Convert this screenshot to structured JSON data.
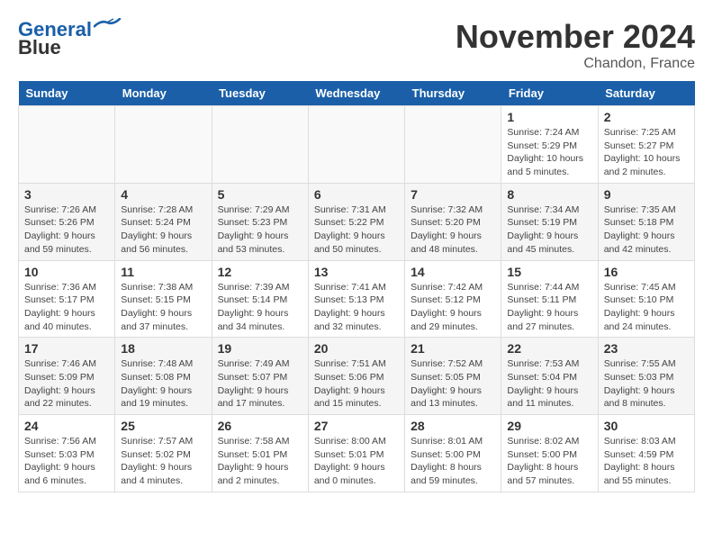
{
  "header": {
    "logo_line1": "General",
    "logo_line2": "Blue",
    "month_title": "November 2024",
    "location": "Chandon, France"
  },
  "weekdays": [
    "Sunday",
    "Monday",
    "Tuesday",
    "Wednesday",
    "Thursday",
    "Friday",
    "Saturday"
  ],
  "weeks": [
    [
      {
        "day": "",
        "info": ""
      },
      {
        "day": "",
        "info": ""
      },
      {
        "day": "",
        "info": ""
      },
      {
        "day": "",
        "info": ""
      },
      {
        "day": "",
        "info": ""
      },
      {
        "day": "1",
        "info": "Sunrise: 7:24 AM\nSunset: 5:29 PM\nDaylight: 10 hours\nand 5 minutes."
      },
      {
        "day": "2",
        "info": "Sunrise: 7:25 AM\nSunset: 5:27 PM\nDaylight: 10 hours\nand 2 minutes."
      }
    ],
    [
      {
        "day": "3",
        "info": "Sunrise: 7:26 AM\nSunset: 5:26 PM\nDaylight: 9 hours\nand 59 minutes."
      },
      {
        "day": "4",
        "info": "Sunrise: 7:28 AM\nSunset: 5:24 PM\nDaylight: 9 hours\nand 56 minutes."
      },
      {
        "day": "5",
        "info": "Sunrise: 7:29 AM\nSunset: 5:23 PM\nDaylight: 9 hours\nand 53 minutes."
      },
      {
        "day": "6",
        "info": "Sunrise: 7:31 AM\nSunset: 5:22 PM\nDaylight: 9 hours\nand 50 minutes."
      },
      {
        "day": "7",
        "info": "Sunrise: 7:32 AM\nSunset: 5:20 PM\nDaylight: 9 hours\nand 48 minutes."
      },
      {
        "day": "8",
        "info": "Sunrise: 7:34 AM\nSunset: 5:19 PM\nDaylight: 9 hours\nand 45 minutes."
      },
      {
        "day": "9",
        "info": "Sunrise: 7:35 AM\nSunset: 5:18 PM\nDaylight: 9 hours\nand 42 minutes."
      }
    ],
    [
      {
        "day": "10",
        "info": "Sunrise: 7:36 AM\nSunset: 5:17 PM\nDaylight: 9 hours\nand 40 minutes."
      },
      {
        "day": "11",
        "info": "Sunrise: 7:38 AM\nSunset: 5:15 PM\nDaylight: 9 hours\nand 37 minutes."
      },
      {
        "day": "12",
        "info": "Sunrise: 7:39 AM\nSunset: 5:14 PM\nDaylight: 9 hours\nand 34 minutes."
      },
      {
        "day": "13",
        "info": "Sunrise: 7:41 AM\nSunset: 5:13 PM\nDaylight: 9 hours\nand 32 minutes."
      },
      {
        "day": "14",
        "info": "Sunrise: 7:42 AM\nSunset: 5:12 PM\nDaylight: 9 hours\nand 29 minutes."
      },
      {
        "day": "15",
        "info": "Sunrise: 7:44 AM\nSunset: 5:11 PM\nDaylight: 9 hours\nand 27 minutes."
      },
      {
        "day": "16",
        "info": "Sunrise: 7:45 AM\nSunset: 5:10 PM\nDaylight: 9 hours\nand 24 minutes."
      }
    ],
    [
      {
        "day": "17",
        "info": "Sunrise: 7:46 AM\nSunset: 5:09 PM\nDaylight: 9 hours\nand 22 minutes."
      },
      {
        "day": "18",
        "info": "Sunrise: 7:48 AM\nSunset: 5:08 PM\nDaylight: 9 hours\nand 19 minutes."
      },
      {
        "day": "19",
        "info": "Sunrise: 7:49 AM\nSunset: 5:07 PM\nDaylight: 9 hours\nand 17 minutes."
      },
      {
        "day": "20",
        "info": "Sunrise: 7:51 AM\nSunset: 5:06 PM\nDaylight: 9 hours\nand 15 minutes."
      },
      {
        "day": "21",
        "info": "Sunrise: 7:52 AM\nSunset: 5:05 PM\nDaylight: 9 hours\nand 13 minutes."
      },
      {
        "day": "22",
        "info": "Sunrise: 7:53 AM\nSunset: 5:04 PM\nDaylight: 9 hours\nand 11 minutes."
      },
      {
        "day": "23",
        "info": "Sunrise: 7:55 AM\nSunset: 5:03 PM\nDaylight: 9 hours\nand 8 minutes."
      }
    ],
    [
      {
        "day": "24",
        "info": "Sunrise: 7:56 AM\nSunset: 5:03 PM\nDaylight: 9 hours\nand 6 minutes."
      },
      {
        "day": "25",
        "info": "Sunrise: 7:57 AM\nSunset: 5:02 PM\nDaylight: 9 hours\nand 4 minutes."
      },
      {
        "day": "26",
        "info": "Sunrise: 7:58 AM\nSunset: 5:01 PM\nDaylight: 9 hours\nand 2 minutes."
      },
      {
        "day": "27",
        "info": "Sunrise: 8:00 AM\nSunset: 5:01 PM\nDaylight: 9 hours\nand 0 minutes."
      },
      {
        "day": "28",
        "info": "Sunrise: 8:01 AM\nSunset: 5:00 PM\nDaylight: 8 hours\nand 59 minutes."
      },
      {
        "day": "29",
        "info": "Sunrise: 8:02 AM\nSunset: 5:00 PM\nDaylight: 8 hours\nand 57 minutes."
      },
      {
        "day": "30",
        "info": "Sunrise: 8:03 AM\nSunset: 4:59 PM\nDaylight: 8 hours\nand 55 minutes."
      }
    ]
  ]
}
